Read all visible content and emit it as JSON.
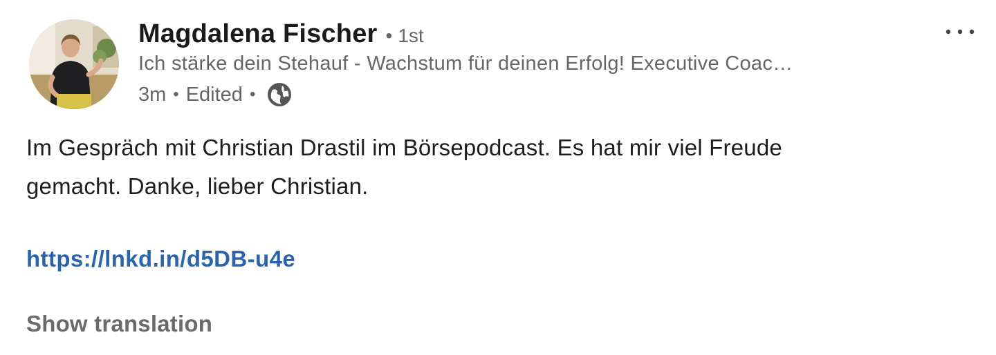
{
  "post": {
    "author": {
      "name": "Magdalena Fischer",
      "separator": "•",
      "connection_degree": "1st",
      "headline": "Ich stärke dein Stehauf - Wachstum für deinen Erfolg! Executive Coac…"
    },
    "meta": {
      "time": "3m",
      "separator": "•",
      "edited": "Edited",
      "separator2": "•",
      "visibility_icon": "globe-icon"
    },
    "more_icon": "more-horizontal-icon",
    "text_line1": "Im Gespräch mit Christian Drastil im Börsepodcast. Es hat mir viel Freude",
    "text_line2": "gemacht. Danke, lieber Christian.",
    "link": "https://lnkd.in/d5DB-u4e",
    "translate_label": "Show translation"
  },
  "colors": {
    "link": "#2a64b1",
    "secondary_text": "#666666",
    "primary_text": "#1d1d1d"
  }
}
